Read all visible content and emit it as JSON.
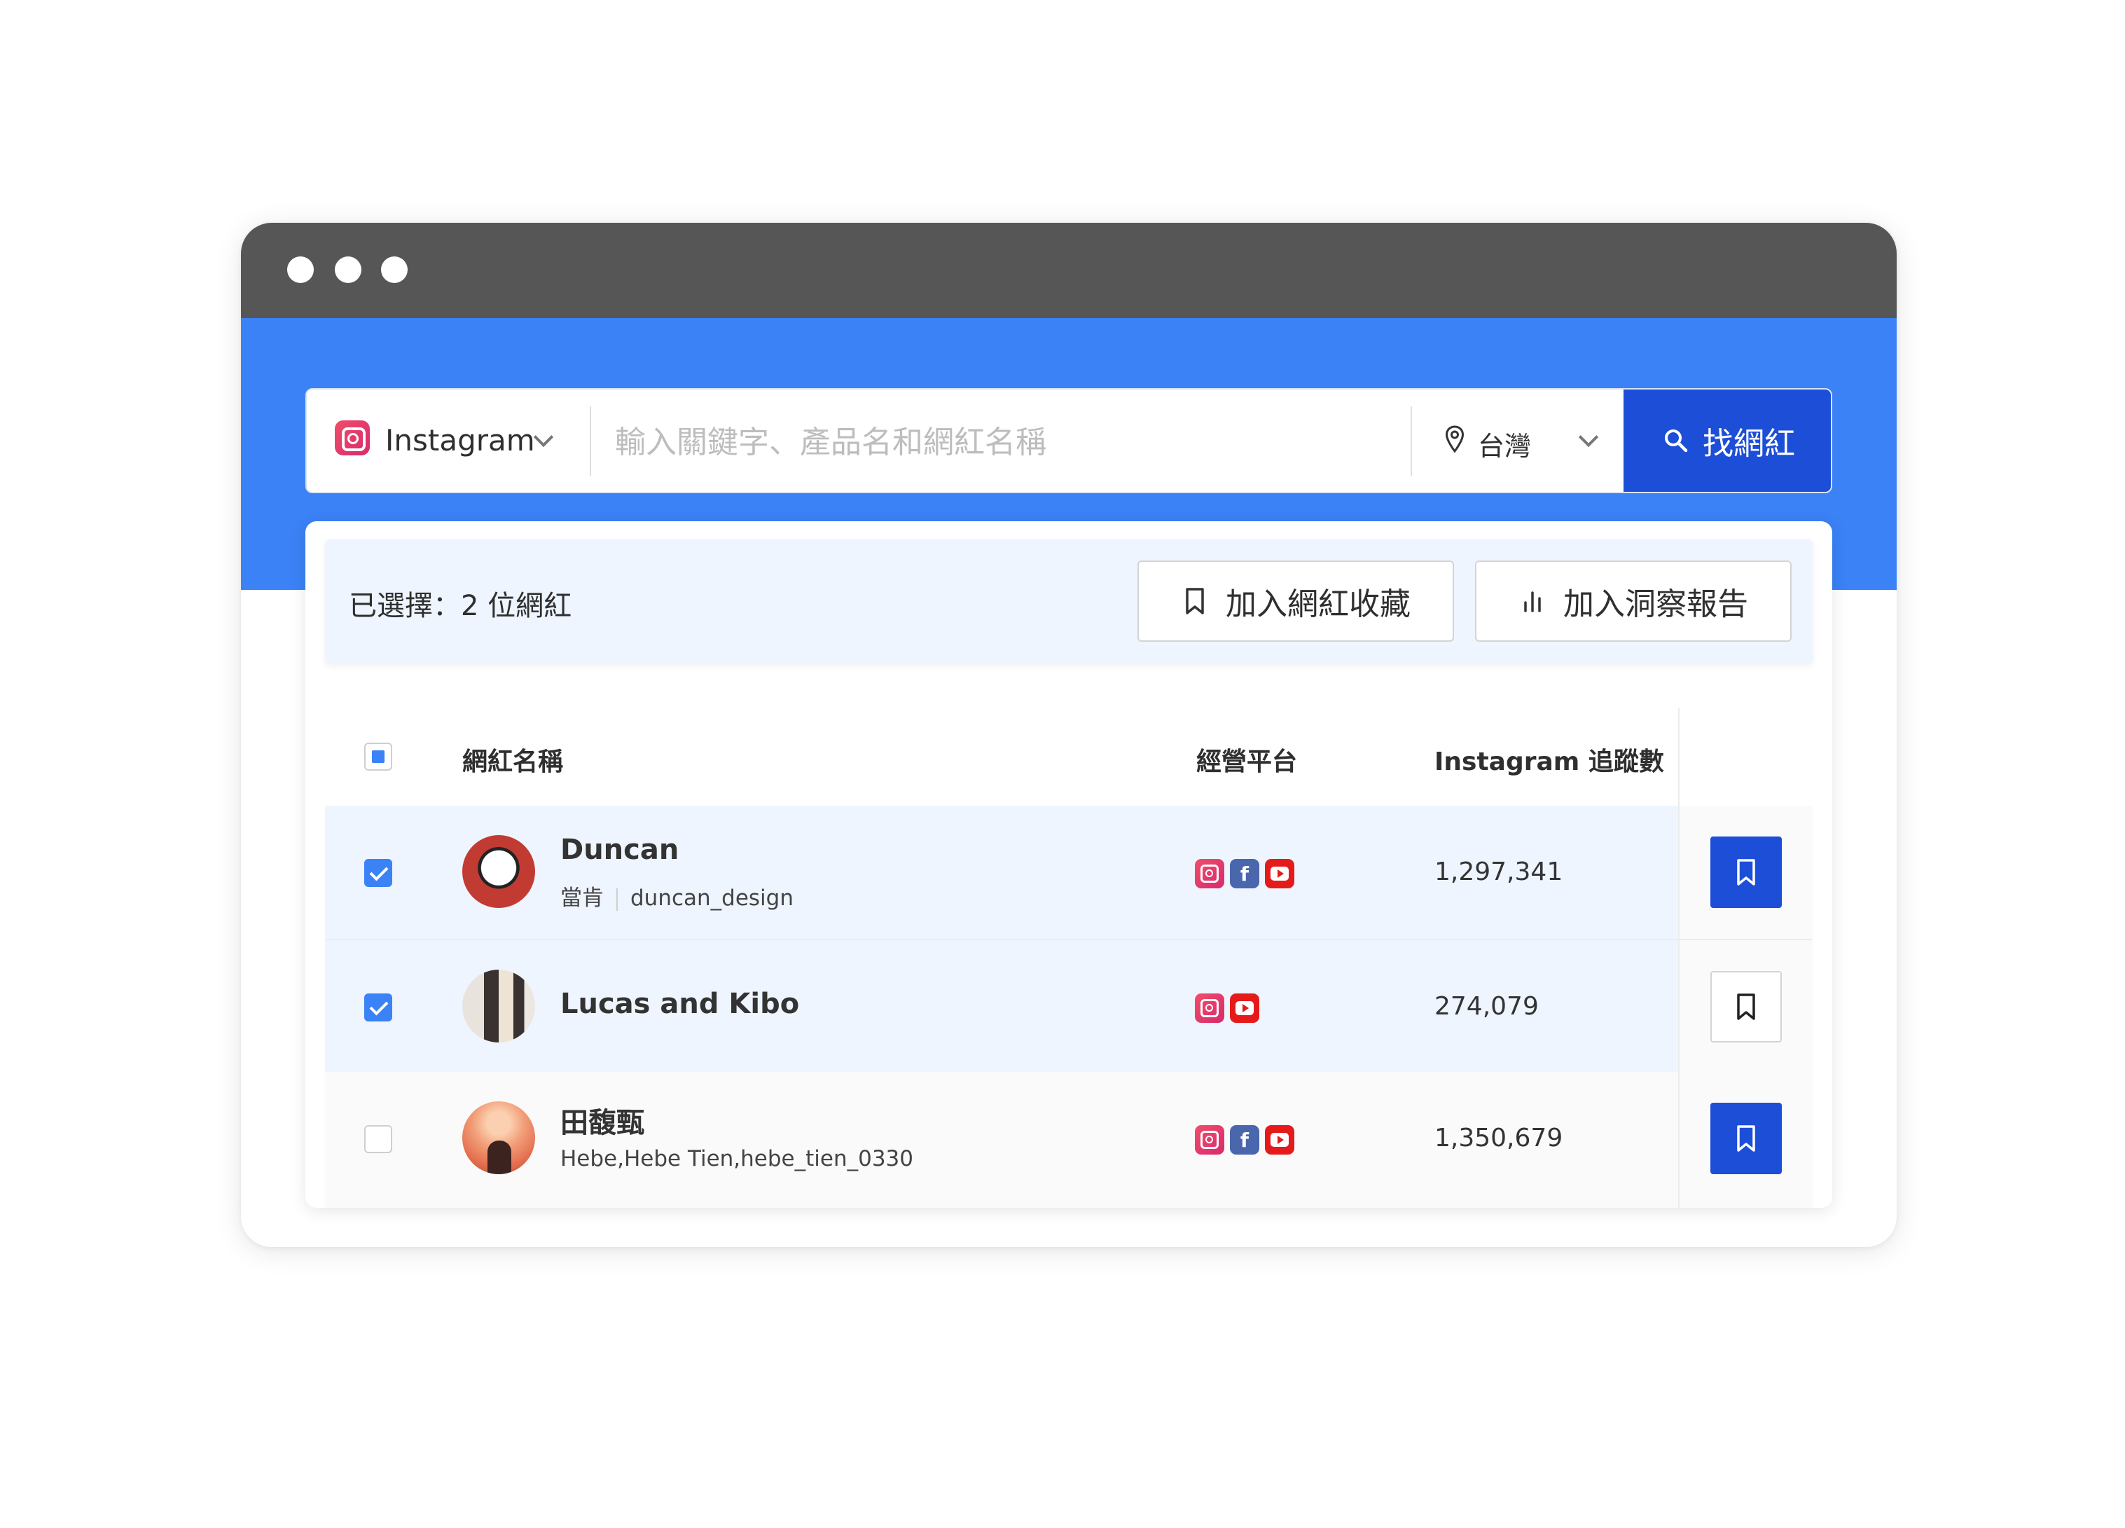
{
  "search": {
    "platform": "Instagram",
    "keyword_placeholder": "輸入關鍵字、產品名和網紅名稱",
    "location": "台灣",
    "submit_label": "找網紅"
  },
  "selection": {
    "summary": "已選擇：2 位網紅",
    "add_favorites_label": "加入網紅收藏",
    "add_report_label": "加入洞察報告"
  },
  "table": {
    "columns": {
      "name": "網紅名稱",
      "platforms": "經營平台",
      "followers": "Instagram 追蹤數"
    },
    "rows": [
      {
        "name": "Duncan",
        "alias": "當肯",
        "handle": "duncan_design",
        "platforms": [
          "instagram",
          "facebook",
          "youtube"
        ],
        "followers": "1,297,341",
        "checked": true,
        "bookmarked": true
      },
      {
        "name": "Lucas and Kibo",
        "platforms": [
          "instagram",
          "youtube"
        ],
        "followers": "274,079",
        "checked": true,
        "bookmarked": false
      },
      {
        "name": "田馥甄",
        "subtitle": "Hebe,Hebe Tien,hebe_tien_0330",
        "platforms": [
          "instagram",
          "facebook",
          "youtube"
        ],
        "followers": "1,350,679",
        "checked": false,
        "bookmarked": true
      }
    ]
  },
  "colors": {
    "accent": "#3b82f6",
    "primary_button": "#1d4ed8",
    "titlebar": "#565656",
    "selected_row": "#eef5fe"
  },
  "icons": {
    "platform_instagram": "instagram-icon",
    "platform_facebook": "facebook-icon",
    "platform_youtube": "youtube-icon",
    "location": "map-pin-icon",
    "search": "search-icon",
    "bookmark": "bookmark-icon",
    "report": "bar-chart-icon"
  }
}
